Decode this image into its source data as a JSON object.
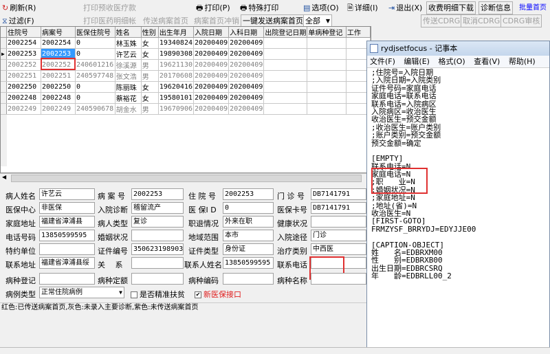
{
  "toolbar": {
    "refresh": "刷新(R)",
    "filter": "过滤(F)",
    "print_pre_bill": "打印预收医疗款",
    "print_detail": "打印医药明细帐",
    "send_front": "传送病案首页",
    "cancel_front": "病案首页冲销",
    "one_key_send": "一键发送病案首页",
    "scope_value": "全部",
    "print": "打印(P)",
    "special_print": "特殊打印",
    "options": "选项(O)",
    "detail": "详细(I)",
    "exit": "退出(X)",
    "fee_download": "收费明细下载",
    "diag_info": "诊断信息",
    "batch_front": "批量首页",
    "send_cdrg": "传送CDRG",
    "cancel_cdrg": "取消CDRG",
    "cdrg_review": "CDRG审核"
  },
  "grid": {
    "columns": [
      "住院号",
      "病案号",
      "医保住院号",
      "姓名",
      "性别",
      "出生年月",
      "入院日期",
      "入科日期",
      "出院登记日期",
      "单病种登记",
      "工作"
    ],
    "rows": [
      {
        "cells": [
          "2002254",
          "2002254",
          "0",
          "林玉姝",
          "女",
          "19340824",
          "20200409",
          "20200409",
          "",
          "",
          ""
        ],
        "gray": false,
        "current": false
      },
      {
        "cells": [
          "2002253",
          "2002253",
          "0",
          "许艺云",
          "女",
          "19890308",
          "20200409",
          "20200409",
          "",
          "",
          ""
        ],
        "gray": false,
        "current": true
      },
      {
        "cells": [
          "2002252",
          "2002252",
          "240601216",
          "徐溪源",
          "男",
          "19621130",
          "20200409",
          "20200409",
          "",
          "",
          ""
        ],
        "gray": true,
        "current": false
      },
      {
        "cells": [
          "2002251",
          "2002251",
          "240597748",
          "张文浩",
          "男",
          "20170608",
          "20200409",
          "20200409",
          "",
          "",
          ""
        ],
        "gray": true,
        "current": false
      },
      {
        "cells": [
          "2002250",
          "2002250",
          "0",
          "陈丽珠",
          "女",
          "19620416",
          "20200409",
          "20200409",
          "",
          "",
          ""
        ],
        "gray": false,
        "current": false
      },
      {
        "cells": [
          "2002248",
          "2002248",
          "0",
          "蔡裕花",
          "女",
          "19580101",
          "20200409",
          "20200409",
          "",
          "",
          ""
        ],
        "gray": false,
        "current": false
      },
      {
        "cells": [
          "2002249",
          "2002249",
          "240590678",
          "胡金水",
          "男",
          "19670906",
          "20200409",
          "20200409",
          "",
          "",
          ""
        ],
        "gray": true,
        "current": false
      }
    ]
  },
  "form": {
    "patient_name_label": "病人姓名",
    "patient_name": "许艺云",
    "case_no_label": "病 案 号",
    "case_no": "2002253",
    "inpatient_no_label": "住 院 号",
    "inpatient_no": "2002253",
    "outpatient_no_label": "门 诊 号",
    "outpatient_no": "DB7141791",
    "insurance_center_label": "医保中心",
    "insurance_center": "非医保",
    "admit_diag_label": "入院诊断",
    "admit_diag": "稽留流产",
    "insurance_id_label": "医 保I D",
    "insurance_id": "0",
    "insurance_card_label": "医保卡号",
    "insurance_card": "DB7141791",
    "home_addr_label": "家庭地址",
    "home_addr": "福建省漳浦县",
    "patient_type_label": "病人类型",
    "patient_type": "复诊",
    "job_status_label": "职退情况",
    "job_status": "外来在职",
    "health_label": "健康状况",
    "health": "",
    "phone_label": "电话号码",
    "phone": "13850599595",
    "marriage_label": "婚姻状况",
    "marriage": "",
    "region_label": "地域范围",
    "region": "本市",
    "admit_route_label": "入院途径",
    "admit_route": "门诊",
    "special_unit_label": "特约单位",
    "special_unit": "",
    "cert_no_label": "证件编号",
    "cert_no": "350623198903",
    "cert_type_label": "证件类型",
    "cert_type": "身份证",
    "treat_type_label": "治疗类别",
    "treat_type": "中西医",
    "contact_addr_label": "联系地址",
    "contact_addr": "福建省漳浦县绥",
    "relation_label": "关　 系",
    "relation": "",
    "contact_name_label": "联系人姓名",
    "contact_name": "13850599595",
    "contact_phone_label": "联系电话",
    "contact_phone": "",
    "disease_reg_label": "病种登记",
    "disease_reg": "",
    "disease_quota_label": "病种定额",
    "disease_quota": "",
    "disease_code_label": "病种编码",
    "disease_code": "",
    "disease_name_label": "病种名称",
    "disease_name": "",
    "case_type_label": "病例类型",
    "case_type": "正常住院病例",
    "poverty_label": "是否精准扶贫",
    "new_interface_label": "新医保接口"
  },
  "status_text": "红色:已传送病案首页,灰色:未录入主要诊断,紫色:未传送病案首页",
  "notepad": {
    "title": "rydjsetfocus - 记事本",
    "menu": [
      "文件(F)",
      "编辑(E)",
      "格式(O)",
      "查看(V)",
      "帮助(H)"
    ],
    "lines": [
      ";住院号=入院日期",
      ";入院日期=入院类别",
      "证件号码=家庭电话",
      "家庭电话=联系电话",
      "联系电话=入院病区",
      "入院病区=收治医生",
      "收治医生=预交金额",
      ";收治医生=账户类别",
      ";账户类别=预交金额",
      "预交金额=确定",
      "",
      "[EMPTY]",
      "联系电话=N",
      "家庭电话=N",
      ";职　　业=N",
      ";婚姻状况=N",
      ";家庭地址=N",
      ";地址(省)=N",
      "收治医生=N",
      "[FIRST-GOTO]",
      "FRMZYSF_BRRYDJ=EDYJJE00",
      "",
      "[CAPTION-OBJECT]",
      "姓　　名=EDBRXM00",
      "性　　别=EDBRXB00",
      "出生日期=EDBRCSRQ",
      "年　　龄=EDBRLL00_2"
    ]
  },
  "colors": {
    "highlight_red": "#e03030",
    "select_blue": "#3399ff",
    "link_blue": "#0000ff"
  }
}
